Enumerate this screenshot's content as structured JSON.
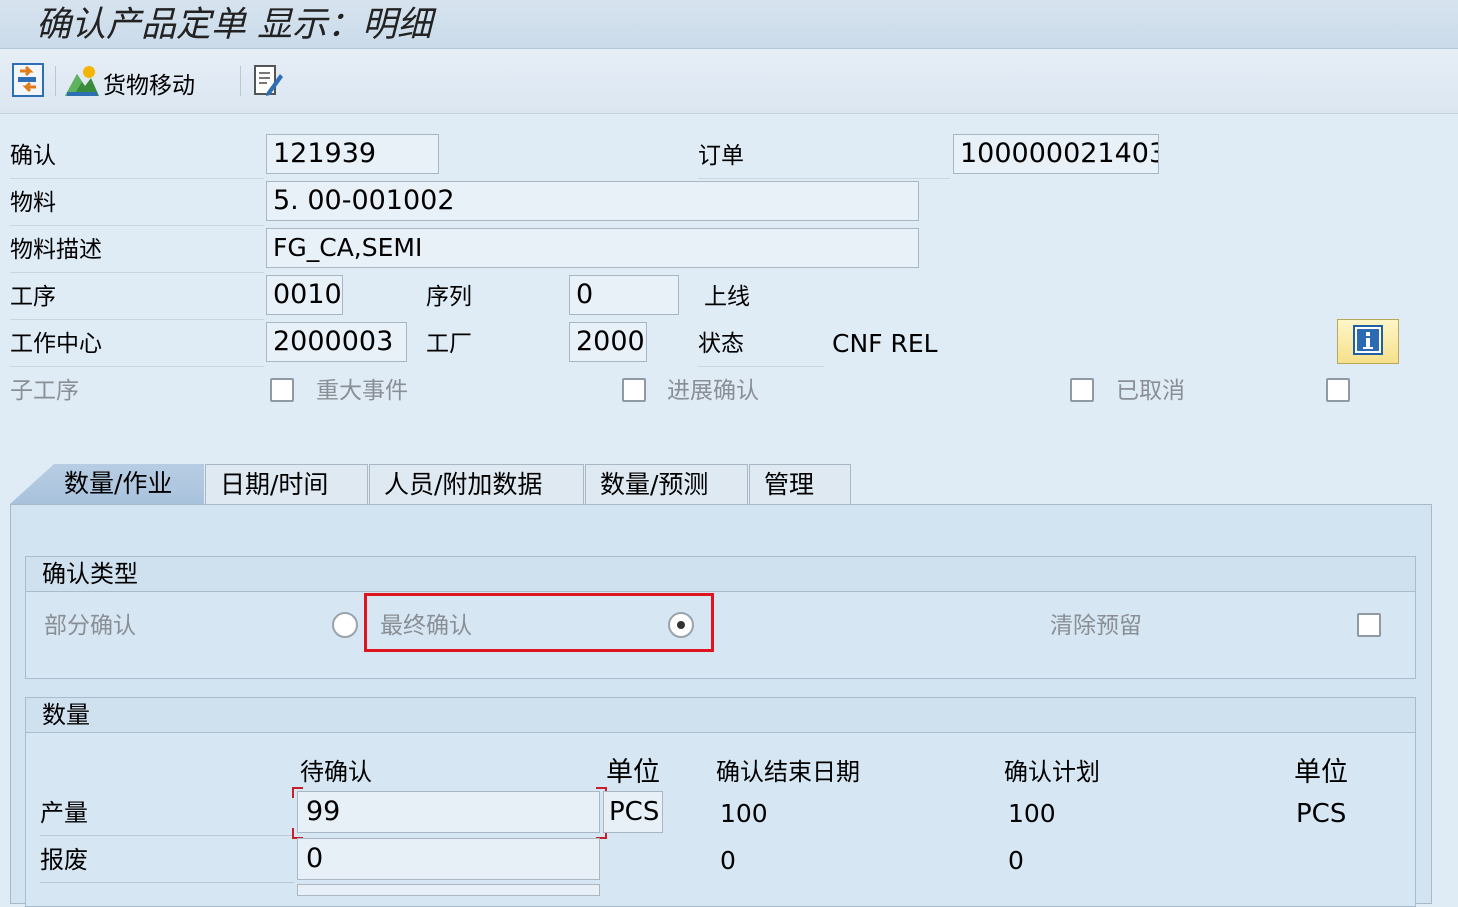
{
  "window": {
    "title": "确认产品定单 显示：明细"
  },
  "toolbar": {
    "goods_movement_label": "货物移动"
  },
  "header": {
    "confirmation": {
      "label": "确认",
      "value": "121939"
    },
    "order": {
      "label": "订单",
      "value": "100000021403"
    },
    "material": {
      "label": "物料",
      "value": "5. 00-001002"
    },
    "material_desc": {
      "label": "物料描述",
      "value": "FG_CA,SEMI"
    },
    "operation": {
      "label": "工序",
      "value": "0010"
    },
    "sequence": {
      "label": "序列",
      "value": "0"
    },
    "online": {
      "label": "上线"
    },
    "work_center": {
      "label": "工作中心",
      "value": "2000003"
    },
    "plant": {
      "label": "工厂",
      "value": "2000"
    },
    "status": {
      "label": "状态",
      "value": "CNF  REL"
    },
    "sub_operation": {
      "label": "子工序"
    },
    "milestone": {
      "label": "重大事件"
    },
    "progress_confirm": {
      "label": "进展确认"
    },
    "cancelled": {
      "label": "已取消"
    }
  },
  "tabs": [
    {
      "label": "数量/作业",
      "active": true
    },
    {
      "label": "日期/时间"
    },
    {
      "label": "人员/附加数据"
    },
    {
      "label": "数量/预测"
    },
    {
      "label": "管理"
    }
  ],
  "confirmation_type": {
    "title": "确认类型",
    "partial": "部分确认",
    "final": "最终确认",
    "selected": "final",
    "clear_reservation": "清除预留"
  },
  "quantity": {
    "title": "数量",
    "columns": {
      "to_confirm": "待确认",
      "unit": "单位",
      "confirmed_end_date": "确认结束日期",
      "confirm_plan": "确认计划",
      "unit2": "单位"
    },
    "yield": {
      "label": "产量",
      "to_confirm": "99",
      "unit": "PCS",
      "confirmed": "100",
      "planned": "100",
      "unit2": "PCS"
    },
    "scrap": {
      "label": "报废",
      "to_confirm": "0",
      "confirmed": "0",
      "planned": "0"
    }
  },
  "colors": {
    "highlight": "#e0141e",
    "active_tab": "#a9c2dc"
  }
}
